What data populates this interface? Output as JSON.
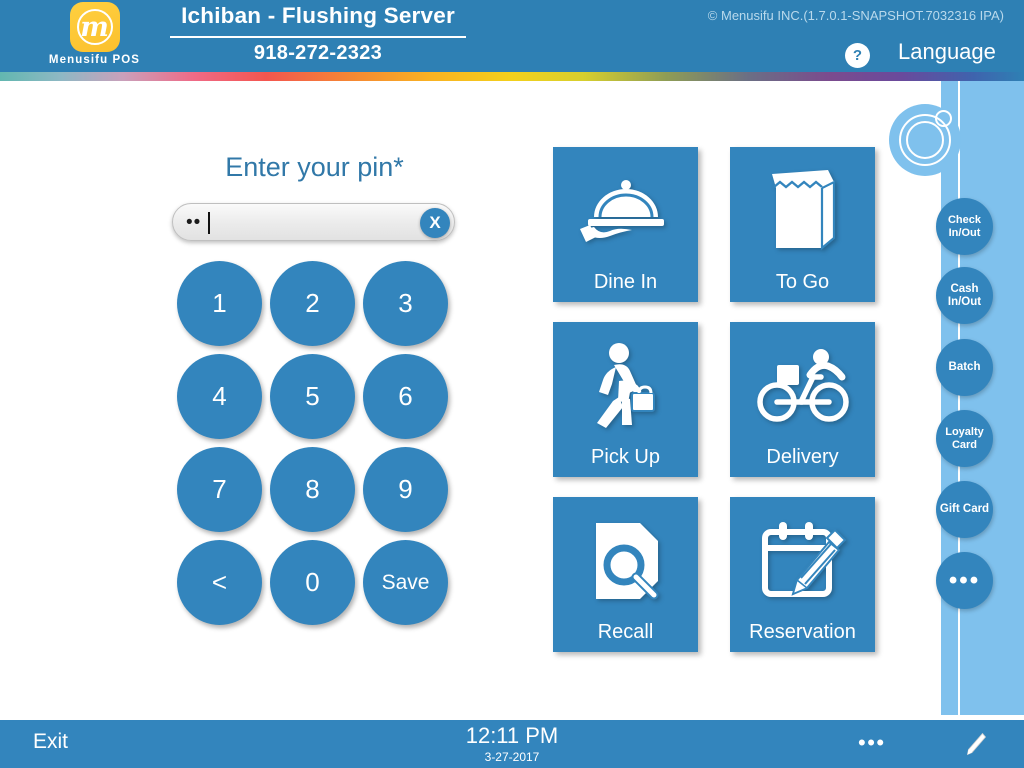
{
  "header": {
    "logo_text": "Menusifu POS",
    "logo_glyph": "m",
    "store_title": "Ichiban - Flushing Server",
    "store_phone": "918-272-2323",
    "copyright": "© Menusifu INC.(1.7.0.1-SNAPSHOT.7032316 IPA)",
    "help_label": "?",
    "language_label": "Language"
  },
  "pin": {
    "heading": "Enter your pin*",
    "value_dots": "••",
    "clear_label": "X"
  },
  "keypad": {
    "keys": [
      {
        "label": "1",
        "name": "key-1"
      },
      {
        "label": "2",
        "name": "key-2"
      },
      {
        "label": "3",
        "name": "key-3"
      },
      {
        "label": "4",
        "name": "key-4"
      },
      {
        "label": "5",
        "name": "key-5"
      },
      {
        "label": "6",
        "name": "key-6"
      },
      {
        "label": "7",
        "name": "key-7"
      },
      {
        "label": "8",
        "name": "key-8"
      },
      {
        "label": "9",
        "name": "key-9"
      },
      {
        "label": "<",
        "name": "key-backspace"
      },
      {
        "label": "0",
        "name": "key-0"
      },
      {
        "label": "Save",
        "name": "key-save"
      }
    ]
  },
  "order_types": [
    {
      "label": "Dine In",
      "icon": "cloche-on-hand-icon"
    },
    {
      "label": "To Go",
      "icon": "paper-bag-icon"
    },
    {
      "label": "Pick Up",
      "icon": "walking-person-with-bag-icon"
    },
    {
      "label": "Delivery",
      "icon": "bicycle-courier-icon"
    },
    {
      "label": "Recall",
      "icon": "document-search-icon"
    },
    {
      "label": "Reservation",
      "icon": "calendar-pencil-icon"
    }
  ],
  "sidebar": {
    "items": [
      {
        "label": "Check In/Out",
        "name": "sidebar-check-in-out"
      },
      {
        "label": "Cash In/Out",
        "name": "sidebar-cash-in-out"
      },
      {
        "label": "Batch",
        "name": "sidebar-batch"
      },
      {
        "label": "Loyalty Card",
        "name": "sidebar-loyalty-card"
      },
      {
        "label": "Gift Card",
        "name": "sidebar-gift-card"
      },
      {
        "label": "•••",
        "name": "sidebar-more"
      }
    ]
  },
  "footer": {
    "exit_label": "Exit",
    "time": "12:11 PM",
    "date": "3-27-2017",
    "more_label": "•••"
  },
  "colors": {
    "header_blue": "#2e80b4",
    "tile_blue": "#3385bd",
    "sidebar_blue": "#7fc1ed",
    "logo_yellow": "#fbc02d",
    "heading_blue": "#3178a8"
  }
}
